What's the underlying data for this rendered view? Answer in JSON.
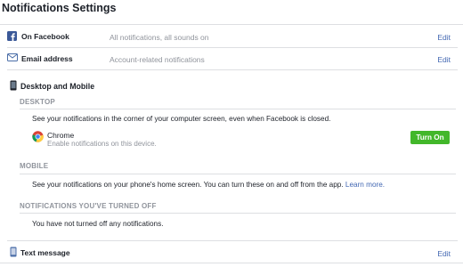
{
  "title": "Notifications Settings",
  "rows": {
    "facebook": {
      "label": "On Facebook",
      "value": "All notifications, all sounds on",
      "action": "Edit"
    },
    "email": {
      "label": "Email address",
      "value": "Account-related notifications",
      "action": "Edit"
    },
    "text": {
      "label": "Text message",
      "action": "Edit"
    }
  },
  "desktop_mobile": {
    "heading": "Desktop and Mobile",
    "desktop": {
      "section": "DESKTOP",
      "description": "See your notifications in the corner of your computer screen, even when Facebook is closed.",
      "browser": "Chrome",
      "browser_sub": "Enable notifications on this device.",
      "button": "Turn On"
    },
    "mobile": {
      "section": "MOBILE",
      "description": "See your notifications on your phone's home screen. You can turn these on and off from the app.",
      "learn_more": "Learn more."
    },
    "turned_off": {
      "section": "NOTIFICATIONS YOU'VE TURNED OFF",
      "description": "You have not turned off any notifications."
    }
  },
  "icons": [
    "facebook-icon",
    "envelope-icon",
    "mobile-phone-icon",
    "chrome-icon",
    "phone-icon"
  ],
  "colors": {
    "link": "#4267b2",
    "button": "#42b72a",
    "muted": "#90949c",
    "divider": "#dddfe2"
  }
}
